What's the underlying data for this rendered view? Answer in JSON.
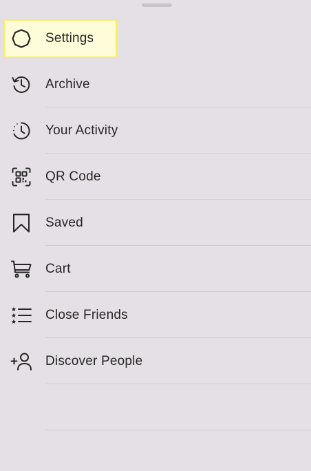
{
  "sheet": {
    "highlight_color": "#fffcd9",
    "highlight_border": "#f4ee6a"
  },
  "menu": {
    "items": [
      {
        "label": "Settings",
        "icon": "settings-icon",
        "highlighted": true
      },
      {
        "label": "Archive",
        "icon": "archive-icon"
      },
      {
        "label": "Your Activity",
        "icon": "activity-icon"
      },
      {
        "label": "QR Code",
        "icon": "qr-code-icon"
      },
      {
        "label": "Saved",
        "icon": "bookmark-icon"
      },
      {
        "label": "Cart",
        "icon": "cart-icon"
      },
      {
        "label": "Close Friends",
        "icon": "close-friends-icon"
      },
      {
        "label": "Discover People",
        "icon": "discover-people-icon"
      }
    ]
  }
}
